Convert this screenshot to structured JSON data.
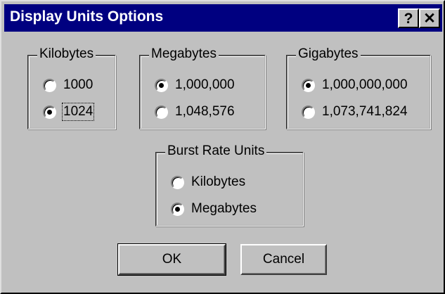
{
  "window": {
    "title": "Display Units Options",
    "help_label": "?",
    "close_label": "✕"
  },
  "kilobytes_group": {
    "legend": "Kilobytes",
    "options": [
      {
        "label": "1000",
        "checked": false
      },
      {
        "label": "1024",
        "checked": true
      }
    ]
  },
  "megabytes_group": {
    "legend": "Megabytes",
    "options": [
      {
        "label": "1,000,000",
        "checked": true
      },
      {
        "label": "1,048,576",
        "checked": false
      }
    ]
  },
  "gigabytes_group": {
    "legend": "Gigabytes",
    "options": [
      {
        "label": "1,000,000,000",
        "checked": true
      },
      {
        "label": "1,073,741,824",
        "checked": false
      }
    ]
  },
  "burst_group": {
    "legend": "Burst Rate Units",
    "options": [
      {
        "label": "Kilobytes",
        "checked": false
      },
      {
        "label": "Megabytes",
        "checked": true
      }
    ]
  },
  "buttons": {
    "ok_label": "OK",
    "cancel_label": "Cancel"
  },
  "colors": {
    "titlebar": "#000080",
    "face": "#c0c0c0"
  }
}
